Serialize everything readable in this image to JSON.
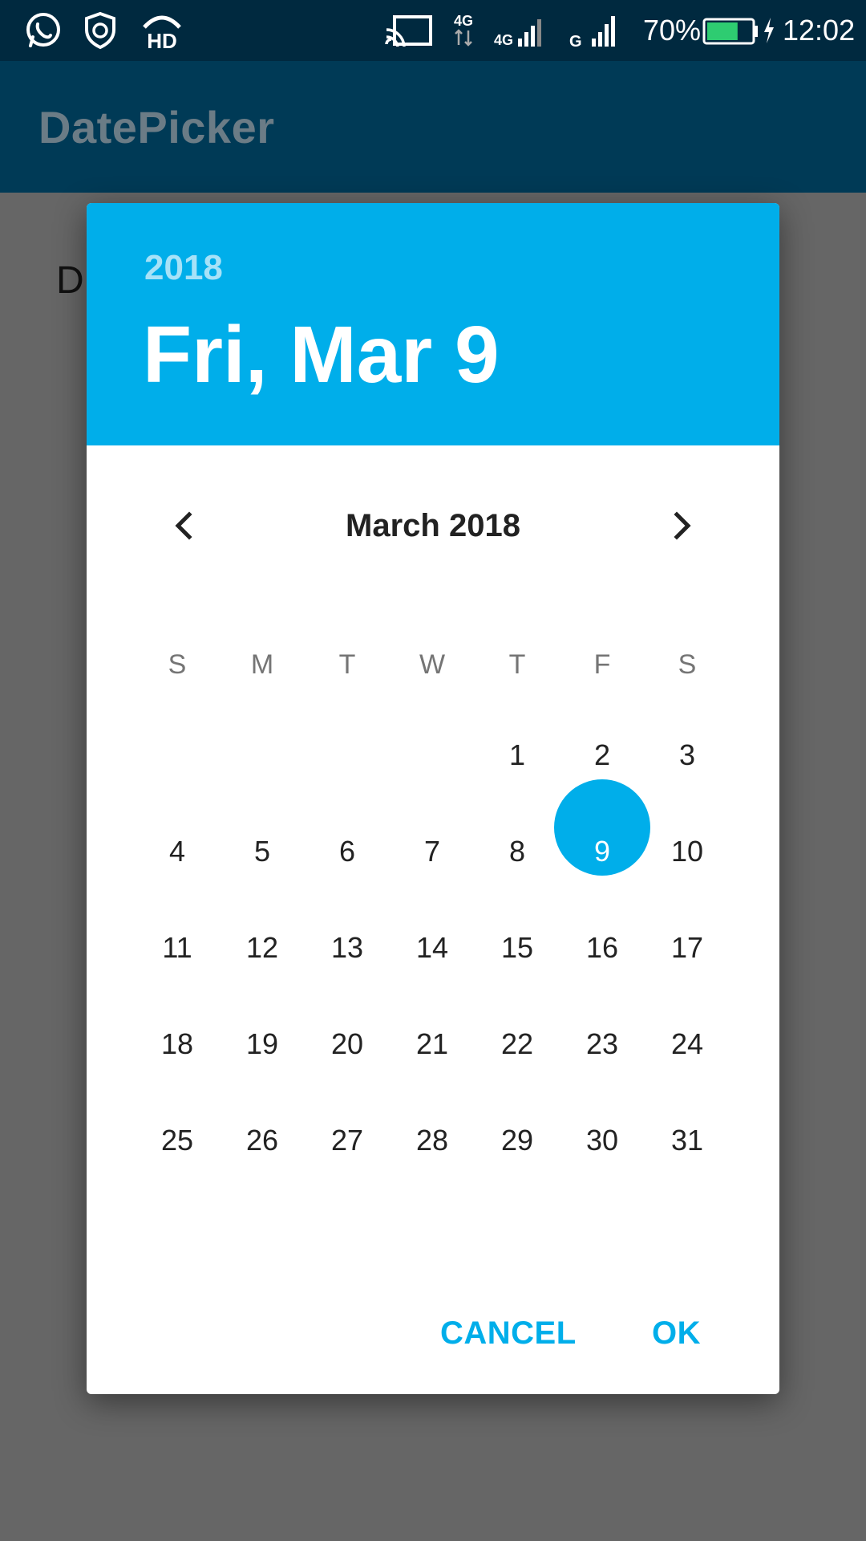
{
  "status_bar": {
    "icons": [
      "whatsapp-icon",
      "shield-icon",
      "hd-call-icon",
      "cast-icon",
      "data-arrows-icon",
      "signal-4g-icon",
      "signal-g-icon",
      "battery-icon",
      "charging-icon"
    ],
    "network_4g_a": "4G",
    "network_4g_b": "4G",
    "network_g": "G",
    "battery_percent": "70%",
    "battery_level": 0.7,
    "time": "12:02"
  },
  "app_bar": {
    "title": "DatePicker"
  },
  "background": {
    "partial_text": "D"
  },
  "dialog": {
    "header": {
      "year": "2018",
      "date": "Fri, Mar 9"
    },
    "month_label": "March 2018",
    "weekdays": [
      "S",
      "M",
      "T",
      "W",
      "T",
      "F",
      "S"
    ],
    "weeks": [
      [
        "",
        "",
        "",
        "",
        "1",
        "2",
        "3"
      ],
      [
        "4",
        "5",
        "6",
        "7",
        "8",
        "9",
        "10"
      ],
      [
        "11",
        "12",
        "13",
        "14",
        "15",
        "16",
        "17"
      ],
      [
        "18",
        "19",
        "20",
        "21",
        "22",
        "23",
        "24"
      ],
      [
        "25",
        "26",
        "27",
        "28",
        "29",
        "30",
        "31"
      ]
    ],
    "selected_day": "9",
    "cancel_label": "CANCEL",
    "ok_label": "OK"
  },
  "colors": {
    "accent": "#00aeea",
    "status_bar": "#00293f",
    "app_bar": "#003a56",
    "scrim": "#666666"
  }
}
